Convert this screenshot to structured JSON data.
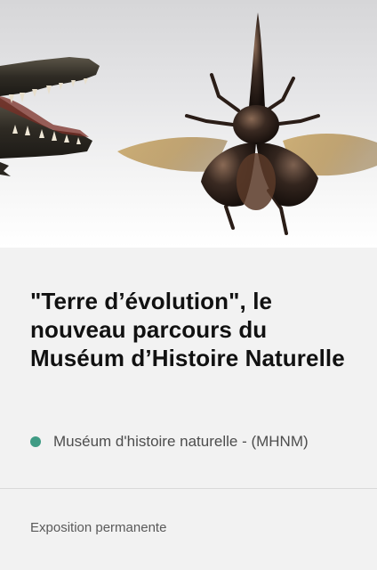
{
  "card": {
    "image": {
      "alt": "Crocodile head and rhinoceros beetle specimens",
      "subjects": [
        "crocodile-head",
        "rhinoceros-beetle"
      ]
    },
    "title": "\"Terre d’évolution\", le nouveau parcours du Muséum d’Histoire Naturelle",
    "location": "Muséum d'histoire naturelle - (MHNM)",
    "category": "Exposition permanente"
  },
  "colors": {
    "background": "#f2f2f2",
    "title": "#111111",
    "location_dot": "#3f9b84",
    "location_text": "#4d4d4d",
    "divider": "#d9d9d9",
    "category_text": "#5a5a5a"
  }
}
